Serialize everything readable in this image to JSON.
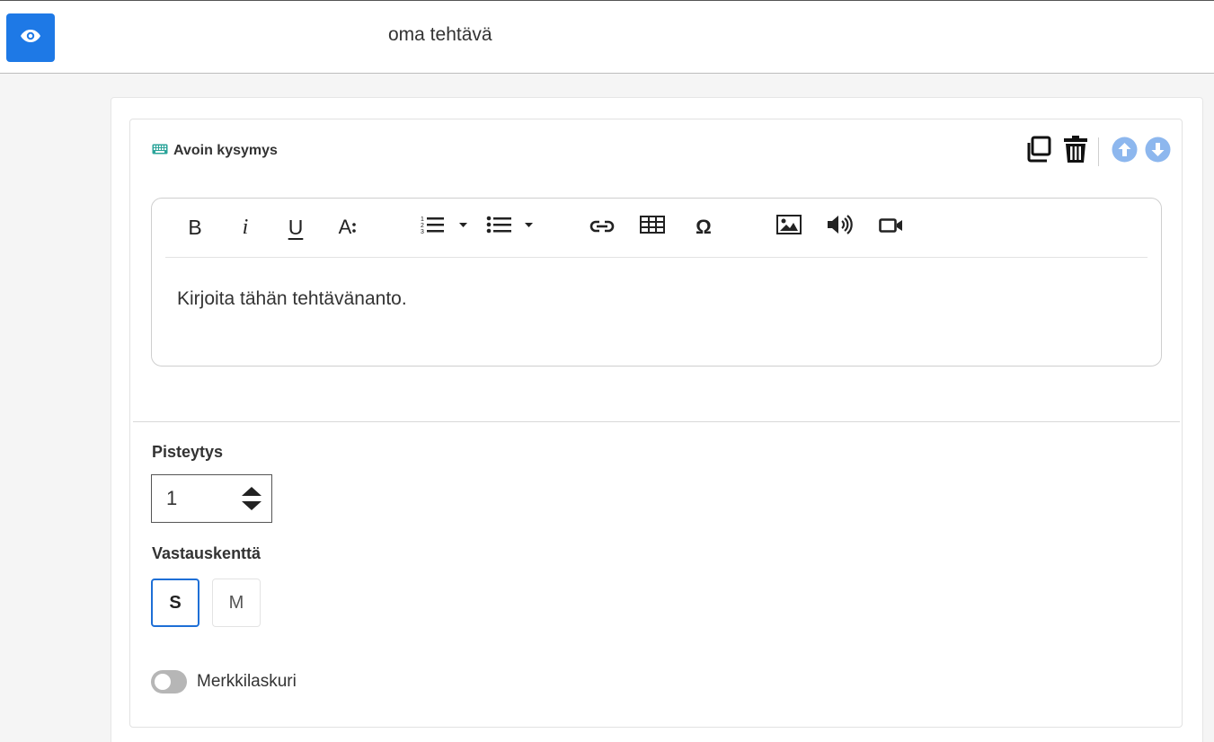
{
  "header": {
    "title": "oma tehtävä",
    "preview_icon": "eye-icon",
    "accent_color": "#1e79e6"
  },
  "task": {
    "type_icon": "keyboard-icon",
    "type_label": "Avoin kysymys",
    "actions": {
      "copy_icon": "copy-icon",
      "delete_icon": "trash-icon",
      "move_up_icon": "arrow-up-circle-icon",
      "move_down_icon": "arrow-down-circle-icon"
    },
    "editor": {
      "toolbar_icons": [
        "bold-icon",
        "italic-icon",
        "underline-icon",
        "font-size-icon",
        "ordered-list-icon",
        "bullet-list-icon",
        "link-icon",
        "table-icon",
        "special-char-icon",
        "image-icon",
        "audio-icon",
        "video-icon"
      ],
      "bold_glyph": "B",
      "italic_glyph": "i",
      "underline_glyph": "U",
      "font_glyph": "A",
      "omega_glyph": "Ω",
      "placeholder": "Kirjoita tähän tehtävänanto."
    },
    "scoring": {
      "label": "Pisteytys",
      "value": "1"
    },
    "answer_field": {
      "label": "Vastauskenttä",
      "options": [
        "S",
        "M"
      ],
      "selected": "S"
    },
    "char_counter": {
      "label": "Merkkilaskuri",
      "enabled": false
    }
  }
}
